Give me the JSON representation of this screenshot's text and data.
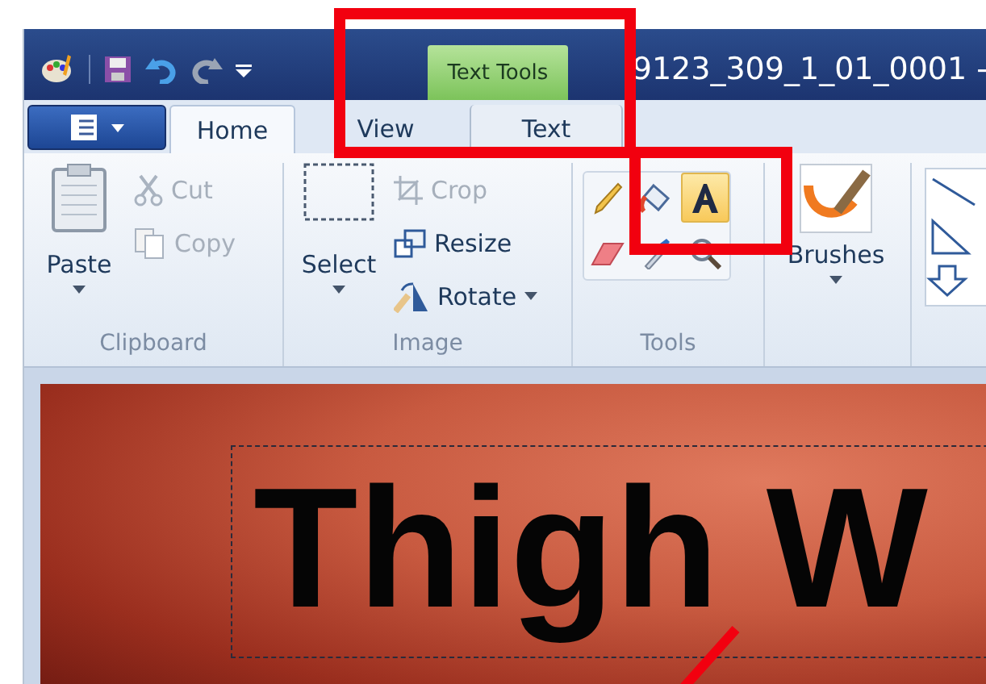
{
  "title_bar": {
    "contextual_tab": "Text Tools",
    "title": "9123_309_1_01_0001 -"
  },
  "ribbon_tabs": [
    {
      "label": "Home",
      "selected": true,
      "contextual": false
    },
    {
      "label": "View",
      "selected": false,
      "contextual": false
    },
    {
      "label": "Text",
      "selected": false,
      "contextual": true
    }
  ],
  "clipboard": {
    "label": "Clipboard",
    "paste": "Paste",
    "small": [
      {
        "kind": "cut",
        "label": "Cut",
        "disabled": true,
        "dropdown": false
      },
      {
        "kind": "copy",
        "label": "Copy",
        "disabled": true,
        "dropdown": false
      }
    ]
  },
  "image": {
    "label": "Image",
    "select": "Select",
    "small": [
      {
        "kind": "crop",
        "label": "Crop",
        "disabled": true,
        "dropdown": false
      },
      {
        "kind": "resize",
        "label": "Resize",
        "disabled": false,
        "dropdown": false
      },
      {
        "kind": "rotate",
        "label": "Rotate",
        "disabled": false,
        "dropdown": true
      }
    ]
  },
  "tools": {
    "label": "Tools",
    "items": [
      {
        "kind": "pencil",
        "selected": false
      },
      {
        "kind": "fill",
        "selected": false
      },
      {
        "kind": "text",
        "selected": true
      },
      {
        "kind": "eraser",
        "selected": false
      },
      {
        "kind": "picker",
        "selected": false
      },
      {
        "kind": "magnifier",
        "selected": false
      }
    ]
  },
  "brushes": {
    "label": "Brushes"
  },
  "canvas": {
    "text": "Thigh W"
  }
}
